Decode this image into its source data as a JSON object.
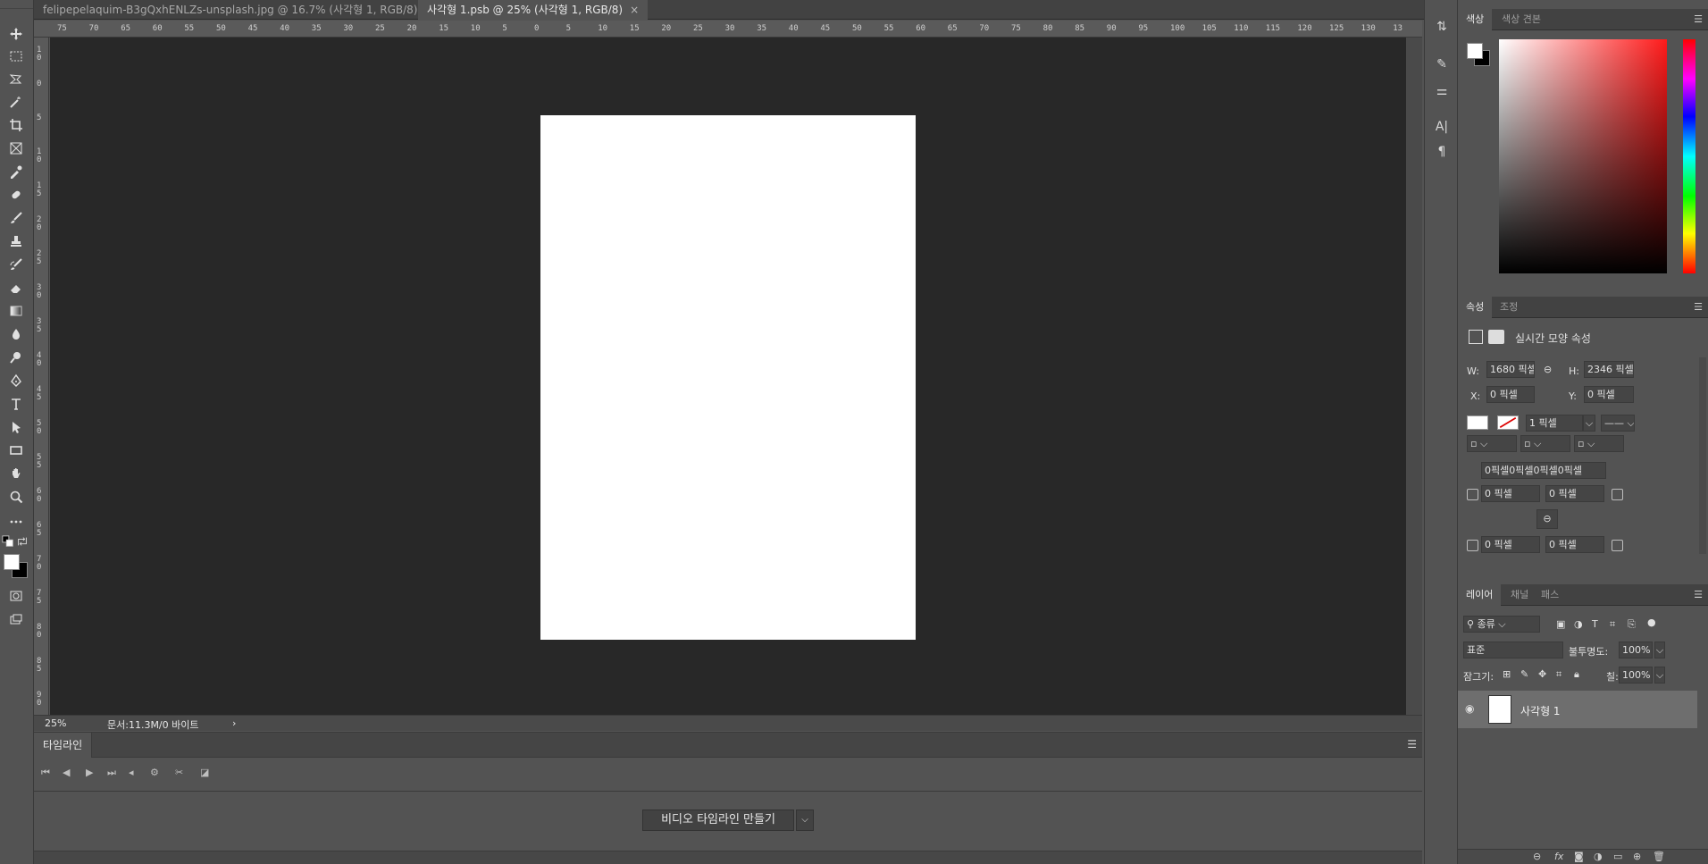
{
  "tabs": [
    {
      "label": "felipepelaquim-B3gQxhENLZs-unsplash.jpg @ 16.7% (사각형 1, RGB/8) *",
      "active": false
    },
    {
      "label": "사각형 1.psb @ 25% (사각형 1, RGB/8)",
      "active": true
    }
  ],
  "tab_close": "×",
  "ruler_h": [
    "75",
    "70",
    "65",
    "60",
    "55",
    "50",
    "45",
    "40",
    "35",
    "30",
    "25",
    "20",
    "15",
    "10",
    "5",
    "0",
    "5",
    "10",
    "15",
    "20",
    "25",
    "30",
    "35",
    "40",
    "45",
    "50",
    "55",
    "60",
    "65",
    "70",
    "75",
    "80",
    "85",
    "90",
    "95",
    "100",
    "105",
    "110",
    "115",
    "120",
    "125",
    "130",
    "13"
  ],
  "ruler_v": [
    "1\n0",
    "0",
    "5",
    "1\n0",
    "1\n5",
    "2\n0",
    "2\n5",
    "3\n0",
    "3\n5",
    "4\n0",
    "4\n5",
    "5\n0",
    "5\n5",
    "6\n0",
    "6\n5",
    "7\n0",
    "7\n5",
    "8\n0",
    "8\n5",
    "9\n0"
  ],
  "status": {
    "zoom": "25%",
    "doc": "문서:11.3M/0 바이트",
    "arrow": "›"
  },
  "timeline": {
    "tab": "타임라인",
    "create_button": "비디오 타임라인 만들기",
    "dropdown": "⌵"
  },
  "color_panel": {
    "tabs": [
      "색상",
      "색상 견본"
    ]
  },
  "properties_panel": {
    "tabs": [
      "속성",
      "조정"
    ],
    "section_title": "실시간 모양 속성",
    "w_label": "W:",
    "w_value": "1680 픽셀",
    "h_label": "H:",
    "h_value": "2346 픽셀",
    "x_label": "X:",
    "x_value": "0 픽셀",
    "y_label": "Y:",
    "y_value": "0 픽셀",
    "stroke_width": "1 픽셀",
    "corners_summary": "0픽셀0픽셀0픽셀0픽셀",
    "corner_tl": "0 픽셀",
    "corner_tr": "0 픽셀",
    "corner_bl": "0 픽셀",
    "corner_br": "0 픽셀"
  },
  "layers_panel": {
    "tabs": [
      "레이어",
      "채널",
      "패스"
    ],
    "filter": "종류",
    "blend_mode": "표준",
    "opacity_label": "불투명도:",
    "opacity_value": "100%",
    "lock_label": "잠그기:",
    "fill_label": "칠:",
    "fill_value": "100%",
    "layers": [
      {
        "name": "사각형 1"
      }
    ]
  },
  "colors": {
    "canvas_bg": "#282828",
    "ui_bg": "#535353",
    "artboard": "#ffffff"
  }
}
